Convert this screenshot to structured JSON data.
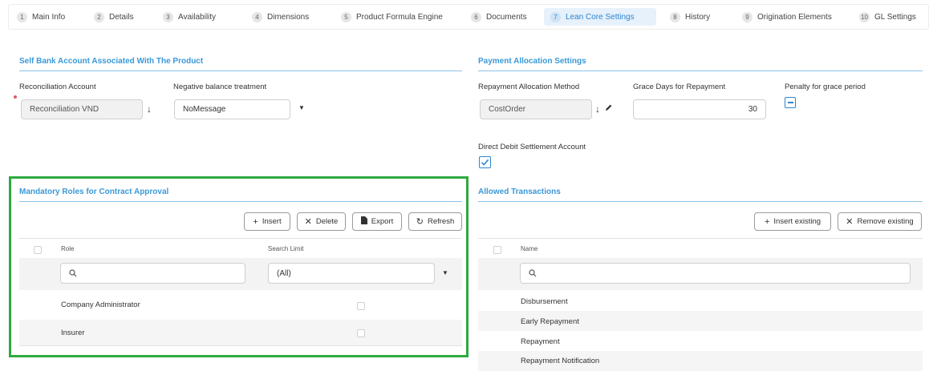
{
  "tabs": [
    {
      "num": "1",
      "label": "Main Info"
    },
    {
      "num": "2",
      "label": "Details"
    },
    {
      "num": "3",
      "label": "Availability"
    },
    {
      "num": "4",
      "label": "Dimensions"
    },
    {
      "num": "5",
      "label": "Product Formula Engine"
    },
    {
      "num": "6",
      "label": "Documents"
    },
    {
      "num": "7",
      "label": "Lean Core Settings"
    },
    {
      "num": "8",
      "label": "History"
    },
    {
      "num": "9",
      "label": "Origination Elements"
    },
    {
      "num": "10",
      "label": "GL Settings"
    }
  ],
  "self_bank": {
    "title": "Self Bank Account Associated With The Product",
    "reconciliation_label": "Reconciliation Account",
    "reconciliation_value": "Reconciliation VND",
    "negative_label": "Negative balance treatment",
    "negative_value": "NoMessage"
  },
  "payment": {
    "title": "Payment Allocation Settings",
    "method_label": "Repayment Allocation Method",
    "method_value": "CostOrder",
    "grace_label": "Grace Days for Repayment",
    "grace_value": "30",
    "penalty_label": "Penalty for grace period",
    "direct_debit_label": "Direct Debit Settlement Account"
  },
  "roles": {
    "title": "Mandatory Roles for Contract Approval",
    "buttons": {
      "insert": "Insert",
      "delete": "Delete",
      "export": "Export",
      "refresh": "Refresh"
    },
    "columns": {
      "role": "Role",
      "search_limit": "Search Limit"
    },
    "filter_select": "(All)",
    "rows": [
      "Company Administrator",
      "Insurer"
    ]
  },
  "allowed": {
    "title": "Allowed Transactions",
    "buttons": {
      "insert_existing": "Insert existing",
      "remove_existing": "Remove existing"
    },
    "columns": {
      "name": "Name"
    },
    "rows": [
      "Disbursement",
      "Early Repayment",
      "Repayment",
      "Repayment Notification"
    ]
  },
  "colors": {
    "accent": "#3a99d8",
    "highlight_border": "#2eaa3f",
    "active_tab_bg": "#e6f1fb"
  }
}
